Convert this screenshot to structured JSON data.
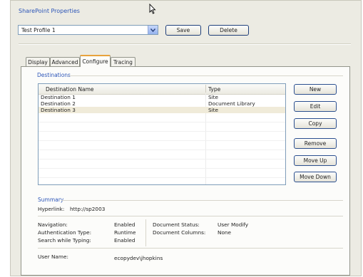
{
  "window": {
    "title": "SharePoint Properties"
  },
  "profile": {
    "selected": "Test Profile 1"
  },
  "toolbar": {
    "save_label": "Save",
    "delete_label": "Delete"
  },
  "tabs": [
    {
      "label": "Display",
      "active": false
    },
    {
      "label": "Advanced",
      "active": false
    },
    {
      "label": "Configure",
      "active": true
    },
    {
      "label": "Tracing",
      "active": false
    }
  ],
  "destinations": {
    "group_title": "Destinations",
    "columns": [
      "Destination Name",
      "Type"
    ],
    "rows": [
      {
        "name": "Destination 1",
        "type": "Site",
        "selected": false
      },
      {
        "name": "Destination 2",
        "type": "Document Library",
        "selected": false
      },
      {
        "name": "Destination 3",
        "type": "Site",
        "selected": true
      }
    ],
    "buttons": {
      "new": "New",
      "edit": "Edit",
      "copy": "Copy",
      "remove": "Remove",
      "move_up": "Move Up",
      "move_down": "Move Down"
    }
  },
  "summary": {
    "group_title": "Summary",
    "hyperlink_label": "Hyperlink:",
    "hyperlink_value": "http://sp2003",
    "navigation_label": "Navigation:",
    "navigation_value": "Enabled",
    "auth_label": "Authentication Type:",
    "auth_value": "Runtime",
    "search_label": "Search while Typing:",
    "search_value": "Enabled",
    "doc_status_label": "Document Status:",
    "doc_status_value": "User Modify",
    "doc_columns_label": "Document Columns:",
    "doc_columns_value": "None",
    "user_label": "User Name:",
    "user_value": "ecopydev\\jhopkins"
  },
  "colors": {
    "accent_blue": "#2c55b8",
    "tab_highlight": "#e8a33d",
    "window_bg": "#ecebe3"
  }
}
